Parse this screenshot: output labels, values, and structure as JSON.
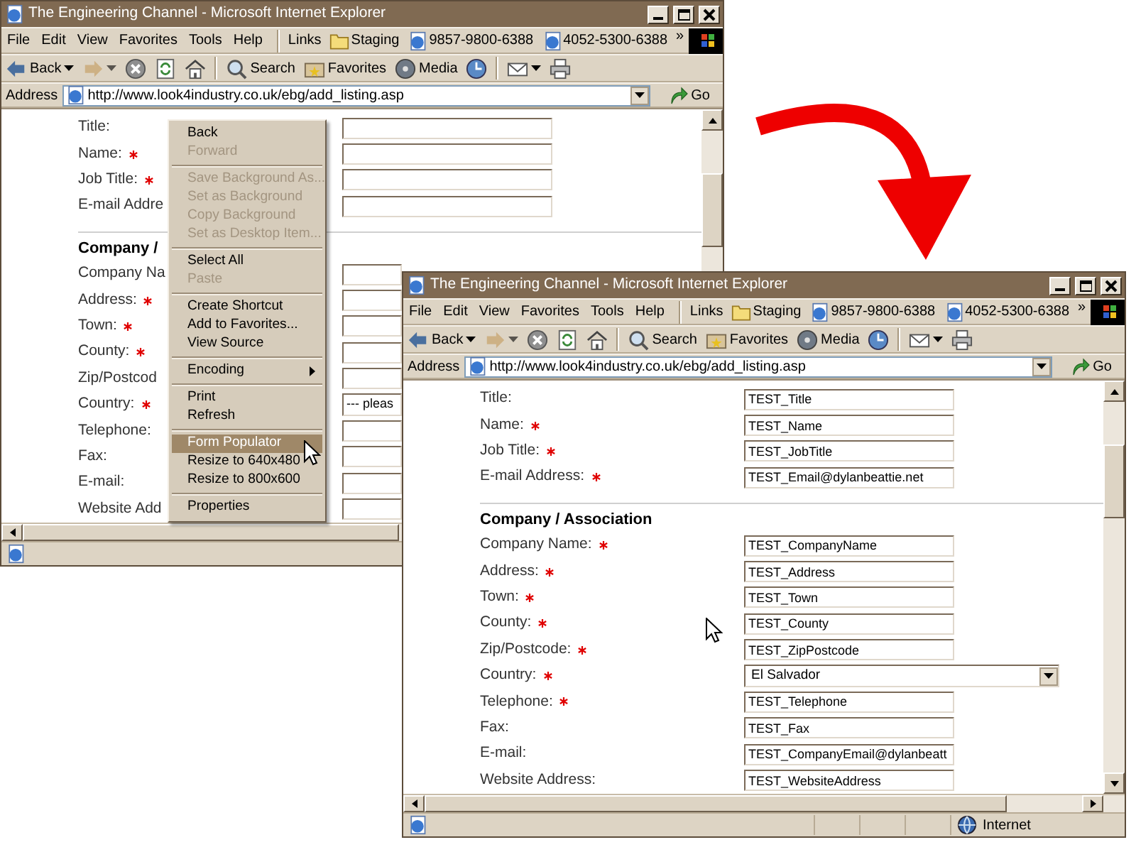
{
  "windows": [
    {
      "title": "The Engineering Channel - Microsoft Internet Explorer",
      "menu": [
        "File",
        "Edit",
        "View",
        "Favorites",
        "Tools",
        "Help"
      ],
      "links": {
        "label": "Links",
        "items": [
          {
            "kind": "folder",
            "label": "Staging"
          },
          {
            "kind": "page",
            "label": "9857-9800-6388"
          },
          {
            "kind": "page",
            "label": "4052-5300-6388"
          }
        ],
        "chevron": "»"
      },
      "toolbar": [
        [
          {
            "kind": "back",
            "label": "Back",
            "dropdown": true,
            "disabled": false
          },
          {
            "kind": "forward",
            "dropdown": true,
            "disabled": true
          },
          {
            "kind": "stop",
            "dropdown": false,
            "disabled": false
          },
          {
            "kind": "refresh",
            "dropdown": false,
            "disabled": false
          },
          {
            "kind": "home",
            "dropdown": false,
            "disabled": false
          }
        ],
        [
          {
            "kind": "search",
            "label": "Search",
            "dropdown": false,
            "disabled": false
          },
          {
            "kind": "favorites",
            "label": "Favorites",
            "dropdown": false,
            "disabled": false
          },
          {
            "kind": "media",
            "label": "Media",
            "dropdown": false,
            "disabled": false
          },
          {
            "kind": "history",
            "dropdown": false,
            "disabled": false
          }
        ],
        [
          {
            "kind": "mail",
            "dropdown": true,
            "disabled": false
          },
          {
            "kind": "print",
            "dropdown": false,
            "disabled": false
          }
        ]
      ],
      "address": {
        "label": "Address",
        "value": "http://www.look4industry.co.uk/ebg/add_listing.asp",
        "go": "Go"
      },
      "form": {
        "personal": [
          {
            "label": "Title:",
            "required": false
          },
          {
            "label": "Name:",
            "required": true
          },
          {
            "label": "Job Title:",
            "required": true
          },
          {
            "label": "E-mail Addre",
            "required": false
          }
        ],
        "section_title": "Company /",
        "company": [
          {
            "kind": "text",
            "label": "Company Na",
            "required": false
          },
          {
            "kind": "text",
            "label": "Address:",
            "required": true
          },
          {
            "kind": "text",
            "label": "Town:",
            "required": true
          },
          {
            "kind": "text",
            "label": "County:",
            "required": true
          },
          {
            "kind": "text",
            "label": "Zip/Postcod",
            "required": false
          },
          {
            "kind": "select",
            "label": "Country:",
            "required": true,
            "value": "--- pleas"
          },
          {
            "kind": "text",
            "label": "Telephone:",
            "required": false
          },
          {
            "kind": "text",
            "label": "Fax:",
            "required": false
          },
          {
            "kind": "text",
            "label": "E-mail:",
            "required": false
          },
          {
            "kind": "text",
            "label": "Website Add",
            "required": false
          }
        ]
      }
    },
    {
      "title": "The Engineering Channel - Microsoft Internet Explorer",
      "menu": [
        "File",
        "Edit",
        "View",
        "Favorites",
        "Tools",
        "Help"
      ],
      "links": {
        "label": "Links",
        "items": [
          {
            "kind": "folder",
            "label": "Staging"
          },
          {
            "kind": "page",
            "label": "9857-9800-6388"
          },
          {
            "kind": "page",
            "label": "4052-5300-6388"
          }
        ],
        "chevron": "»"
      },
      "toolbar": [
        [
          {
            "kind": "back",
            "label": "Back",
            "dropdown": true,
            "disabled": false
          },
          {
            "kind": "forward",
            "dropdown": true,
            "disabled": true
          },
          {
            "kind": "stop",
            "dropdown": false,
            "disabled": false
          },
          {
            "kind": "refresh",
            "dropdown": false,
            "disabled": false
          },
          {
            "kind": "home",
            "dropdown": false,
            "disabled": false
          }
        ],
        [
          {
            "kind": "search",
            "label": "Search",
            "dropdown": false,
            "disabled": false
          },
          {
            "kind": "favorites",
            "label": "Favorites",
            "dropdown": false,
            "disabled": false
          },
          {
            "kind": "media",
            "label": "Media",
            "dropdown": false,
            "disabled": false
          },
          {
            "kind": "history",
            "dropdown": false,
            "disabled": false
          }
        ],
        [
          {
            "kind": "mail",
            "dropdown": true,
            "disabled": false
          },
          {
            "kind": "print",
            "dropdown": false,
            "disabled": false
          }
        ]
      ],
      "address": {
        "label": "Address",
        "value": "http://www.look4industry.co.uk/ebg/add_listing.asp",
        "go": "Go"
      },
      "form": {
        "personal": [
          {
            "label": "Title:",
            "required": false,
            "value": "TEST_Title"
          },
          {
            "label": "Name:",
            "required": true,
            "value": "TEST_Name"
          },
          {
            "label": "Job Title:",
            "required": true,
            "value": "TEST_JobTitle"
          },
          {
            "label": "E-mail Address:",
            "required": true,
            "value": "TEST_Email@dylanbeattie.net"
          }
        ],
        "section_title": "Company / Association",
        "company": [
          {
            "kind": "text",
            "label": "Company Name:",
            "required": true,
            "value": "TEST_CompanyName"
          },
          {
            "kind": "text",
            "label": "Address:",
            "required": true,
            "value": "TEST_Address"
          },
          {
            "kind": "text",
            "label": "Town:",
            "required": true,
            "value": "TEST_Town"
          },
          {
            "kind": "text",
            "label": "County:",
            "required": true,
            "value": "TEST_County"
          },
          {
            "kind": "text",
            "label": "Zip/Postcode:",
            "required": true,
            "value": "TEST_ZipPostcode"
          },
          {
            "kind": "select",
            "label": "Country:",
            "required": true,
            "value": "El Salvador"
          },
          {
            "kind": "text",
            "label": "Telephone:",
            "required": true,
            "value": "TEST_Telephone"
          },
          {
            "kind": "text",
            "label": "Fax:",
            "required": false,
            "value": "TEST_Fax"
          },
          {
            "kind": "text",
            "label": "E-mail:",
            "required": false,
            "value": "TEST_CompanyEmail@dylanbeatt"
          },
          {
            "kind": "text",
            "label": "Website Address:",
            "required": false,
            "value": "TEST_WebsiteAddress"
          }
        ]
      },
      "status_bar": {
        "zone": "Internet"
      }
    }
  ],
  "context_menu": {
    "groups": [
      [
        {
          "label": "Back",
          "disabled": false,
          "selected": false,
          "submenu": false
        },
        {
          "label": "Forward",
          "disabled": true,
          "selected": false,
          "submenu": false
        }
      ],
      [
        {
          "label": "Save Background As...",
          "disabled": true,
          "selected": false,
          "submenu": false
        },
        {
          "label": "Set as Background",
          "disabled": true,
          "selected": false,
          "submenu": false
        },
        {
          "label": "Copy Background",
          "disabled": true,
          "selected": false,
          "submenu": false
        },
        {
          "label": "Set as Desktop Item...",
          "disabled": true,
          "selected": false,
          "submenu": false
        }
      ],
      [
        {
          "label": "Select All",
          "disabled": false,
          "selected": false,
          "submenu": false
        },
        {
          "label": "Paste",
          "disabled": true,
          "selected": false,
          "submenu": false
        }
      ],
      [
        {
          "label": "Create Shortcut",
          "disabled": false,
          "selected": false,
          "submenu": false
        },
        {
          "label": "Add to Favorites...",
          "disabled": false,
          "selected": false,
          "submenu": false
        },
        {
          "label": "View Source",
          "disabled": false,
          "selected": false,
          "submenu": false
        }
      ],
      [
        {
          "label": "Encoding",
          "disabled": false,
          "selected": false,
          "submenu": true
        }
      ],
      [
        {
          "label": "Print",
          "disabled": false,
          "selected": false,
          "submenu": false
        },
        {
          "label": "Refresh",
          "disabled": false,
          "selected": false,
          "submenu": false
        }
      ],
      [
        {
          "label": "Form Populator",
          "disabled": false,
          "selected": true,
          "submenu": false
        },
        {
          "label": "Resize to 640x480",
          "disabled": false,
          "selected": false,
          "submenu": false
        },
        {
          "label": "Resize to 800x600",
          "disabled": false,
          "selected": false,
          "submenu": false
        }
      ],
      [
        {
          "label": "Properties",
          "disabled": false,
          "selected": false,
          "submenu": false
        }
      ]
    ]
  }
}
